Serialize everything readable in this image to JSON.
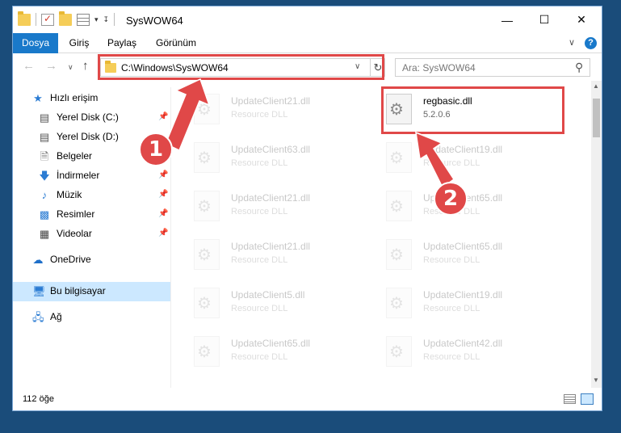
{
  "window": {
    "title": "SysWOW64",
    "controls": {
      "minimize": "—",
      "maximize": "☐",
      "close": "✕"
    }
  },
  "ribbon": {
    "tabs": [
      {
        "label": "Dosya",
        "active": true
      },
      {
        "label": "Giriş"
      },
      {
        "label": "Paylaş"
      },
      {
        "label": "Görünüm"
      }
    ],
    "help": "?"
  },
  "navbar": {
    "address": "C:\\Windows\\SysWOW64",
    "search_placeholder": "Ara: SysWOW64"
  },
  "sidebar": {
    "items": [
      {
        "label": "Hızlı erişim",
        "icon": "star-icon"
      },
      {
        "label": "Yerel Disk (C:)",
        "icon": "drive-icon",
        "pinned": true
      },
      {
        "label": "Yerel Disk (D:)",
        "icon": "drive-icon"
      },
      {
        "label": "Belgeler",
        "icon": "documents-icon"
      },
      {
        "label": "İndirmeler",
        "icon": "download-icon",
        "pinned": true
      },
      {
        "label": "Müzik",
        "icon": "music-icon",
        "pinned": true
      },
      {
        "label": "Resimler",
        "icon": "pictures-icon",
        "pinned": true
      },
      {
        "label": "Videolar",
        "icon": "videos-icon",
        "pinned": true
      },
      {
        "label": "OneDrive",
        "icon": "cloud-icon"
      },
      {
        "label": "Bu bilgisayar",
        "icon": "computer-icon",
        "selected": true
      },
      {
        "label": "Ağ",
        "icon": "network-icon"
      }
    ]
  },
  "files": {
    "left": [
      {
        "name": "UpdateClient21.dll",
        "sub": "Resource DLL"
      },
      {
        "name": "UpdateClient63.dll",
        "sub": "Resource DLL"
      },
      {
        "name": "UpdateClient21.dll",
        "sub": "Resource DLL"
      },
      {
        "name": "UpdateClient21.dll",
        "sub": "Resource DLL"
      },
      {
        "name": "UpdateClient5.dll",
        "sub": "Resource DLL"
      },
      {
        "name": "UpdateClient65.dll",
        "sub": "Resource DLL"
      }
    ],
    "right": [
      {
        "name": "regbasic.dll",
        "sub": "5.2.0.6",
        "highlighted": true
      },
      {
        "name": "UpdateClient19.dll",
        "sub": "Resource DLL"
      },
      {
        "name": "UpdateClient65.dll",
        "sub": "Resource DLL"
      },
      {
        "name": "UpdateClient65.dll",
        "sub": "Resource DLL"
      },
      {
        "name": "UpdateClient19.dll",
        "sub": "Resource DLL"
      },
      {
        "name": "UpdateClient42.dll",
        "sub": "Resource DLL"
      }
    ]
  },
  "status": {
    "count": "112 öğe"
  },
  "annotations": {
    "step1": "1",
    "step2": "2",
    "color": "#e04848"
  }
}
